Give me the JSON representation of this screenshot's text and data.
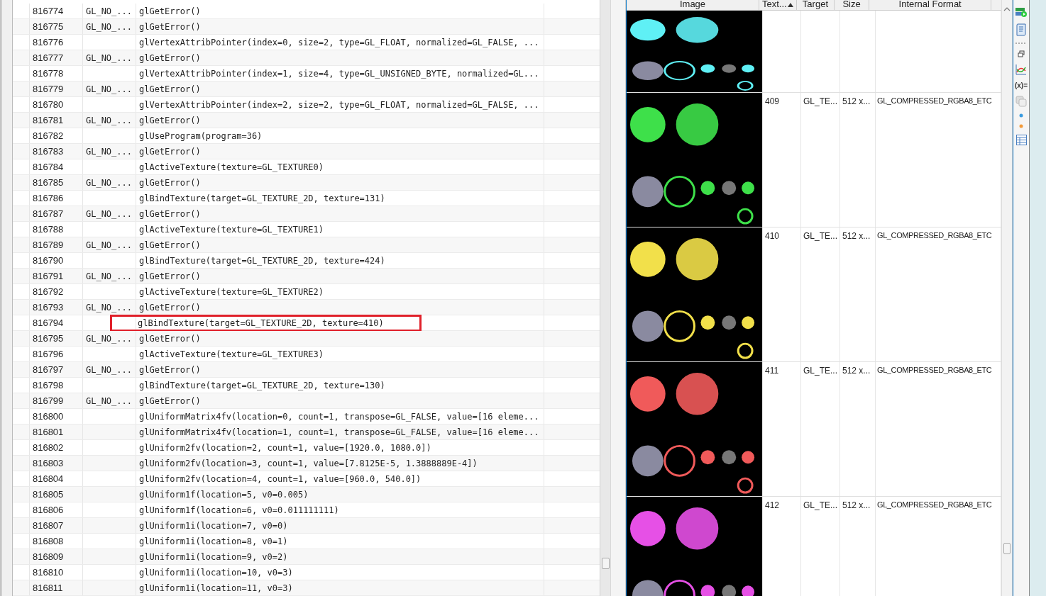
{
  "calls_table": {
    "rows": [
      {
        "id": "816774",
        "error": "GL_NO_...",
        "call": "glGetError()",
        "marked": false
      },
      {
        "id": "816775",
        "error": "GL_NO_...",
        "call": "glGetError()",
        "marked": false
      },
      {
        "id": "816776",
        "call": "glVertexAttribPointer(index=0, size=2, type=GL_FLOAT, normalized=GL_FALSE, ...",
        "marked": false
      },
      {
        "id": "816777",
        "error": "GL_NO_...",
        "call": "glGetError()",
        "marked": false
      },
      {
        "id": "816778",
        "call": "glVertexAttribPointer(index=1, size=4, type=GL_UNSIGNED_BYTE, normalized=GL...",
        "marked": false
      },
      {
        "id": "816779",
        "error": "GL_NO_...",
        "call": "glGetError()",
        "marked": false
      },
      {
        "id": "816780",
        "call": "glVertexAttribPointer(index=2, size=2, type=GL_FLOAT, normalized=GL_FALSE, ...",
        "marked": false
      },
      {
        "id": "816781",
        "error": "GL_NO_...",
        "call": "glGetError()",
        "marked": false
      },
      {
        "id": "816782",
        "call": "glUseProgram(program=36)",
        "marked": false
      },
      {
        "id": "816783",
        "error": "GL_NO_...",
        "call": "glGetError()",
        "marked": false
      },
      {
        "id": "816784",
        "call": "glActiveTexture(texture=GL_TEXTURE0)",
        "marked": false
      },
      {
        "id": "816785",
        "error": "GL_NO_...",
        "call": "glGetError()",
        "marked": false
      },
      {
        "id": "816786",
        "call": "glBindTexture(target=GL_TEXTURE_2D, texture=131)",
        "marked": false
      },
      {
        "id": "816787",
        "error": "GL_NO_...",
        "call": "glGetError()",
        "marked": false
      },
      {
        "id": "816788",
        "call": "glActiveTexture(texture=GL_TEXTURE1)",
        "marked": false
      },
      {
        "id": "816789",
        "error": "GL_NO_...",
        "call": "glGetError()",
        "marked": false
      },
      {
        "id": "816790",
        "call": "glBindTexture(target=GL_TEXTURE_2D, texture=424)",
        "marked": false
      },
      {
        "id": "816791",
        "error": "GL_NO_...",
        "call": "glGetError()",
        "marked": false
      },
      {
        "id": "816792",
        "call": "glActiveTexture(texture=GL_TEXTURE2)",
        "marked": false
      },
      {
        "id": "816793",
        "error": "GL_NO_...",
        "call": "glGetError()",
        "marked": false
      },
      {
        "id": "816794",
        "call": "glBindTexture(target=GL_TEXTURE_2D, texture=410)",
        "marked": true
      },
      {
        "id": "816795",
        "error": "GL_NO_...",
        "call": "glGetError()",
        "marked": false
      },
      {
        "id": "816796",
        "call": "glActiveTexture(texture=GL_TEXTURE3)",
        "marked": false
      },
      {
        "id": "816797",
        "error": "GL_NO_...",
        "call": "glGetError()",
        "marked": false
      },
      {
        "id": "816798",
        "call": "glBindTexture(target=GL_TEXTURE_2D, texture=130)",
        "marked": false
      },
      {
        "id": "816799",
        "error": "GL_NO_...",
        "call": "glGetError()",
        "marked": false
      },
      {
        "id": "816800",
        "call": "glUniformMatrix4fv(location=0, count=1, transpose=GL_FALSE, value=[16 eleme...",
        "marked": false
      },
      {
        "id": "816801",
        "call": "glUniformMatrix4fv(location=1, count=1, transpose=GL_FALSE, value=[16 eleme...",
        "marked": false
      },
      {
        "id": "816802",
        "call": "glUniform2fv(location=2, count=1, value=[1920.0, 1080.0])",
        "marked": false
      },
      {
        "id": "816803",
        "call": "glUniform2fv(location=3, count=1, value=[7.8125E-5, 1.3888889E-4])",
        "marked": false
      },
      {
        "id": "816804",
        "call": "glUniform2fv(location=4, count=1, value=[960.0, 540.0])",
        "marked": false
      },
      {
        "id": "816805",
        "call": "glUniform1f(location=5, v0=0.005)",
        "marked": false
      },
      {
        "id": "816806",
        "call": "glUniform1f(location=6, v0=0.011111111)",
        "marked": false
      },
      {
        "id": "816807",
        "call": "glUniform1i(location=7, v0=0)",
        "marked": false
      },
      {
        "id": "816808",
        "call": "glUniform1i(location=8, v0=1)",
        "marked": false
      },
      {
        "id": "816809",
        "call": "glUniform1i(location=9, v0=2)",
        "marked": false
      },
      {
        "id": "816810",
        "call": "glUniform1i(location=10, v0=3)",
        "marked": false
      },
      {
        "id": "816811",
        "call": "glUniform1i(location=11, v0=3)",
        "marked": false
      }
    ]
  },
  "toolbar": {
    "expressions_label": "(x)="
  },
  "textures_table": {
    "columns": [
      "Image",
      "Text...",
      "Target",
      "Size",
      "Internal Format"
    ],
    "rows": [
      {
        "color": "#5ff0f5"
      },
      {
        "id": "409",
        "target": "GL_TE...",
        "size": "512 x...",
        "format": "GL_COMPRESSED_RGBA8_ETC",
        "color": "#3ee04a"
      },
      {
        "id": "410",
        "target": "GL_TE...",
        "size": "512 x...",
        "format": "GL_COMPRESSED_RGBA8_ETC",
        "color": "#f2e04a"
      },
      {
        "id": "411",
        "target": "GL_TE...",
        "size": "512 x...",
        "format": "GL_COMPRESSED_RGBA8_ETC",
        "color": "#f05a5a"
      },
      {
        "id": "412",
        "target": "GL_TE...",
        "size": "512 x...",
        "format": "GL_COMPRESSED_RGBA8_ETC",
        "color": "#e650e6"
      }
    ]
  }
}
